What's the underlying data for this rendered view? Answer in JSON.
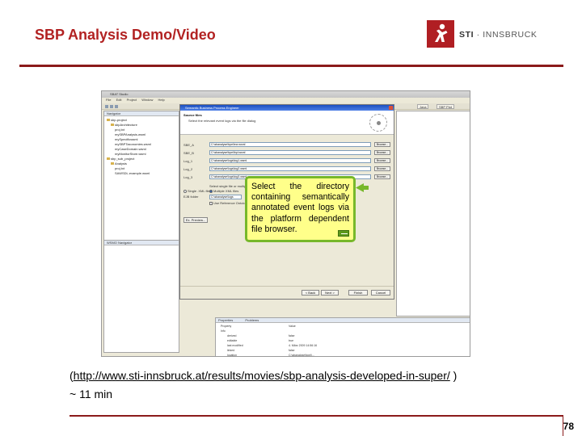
{
  "slide": {
    "title": "SBP Analysis Demo/Video",
    "page_number": "78"
  },
  "logo": {
    "brand": "STI",
    "separator": " · ",
    "place": "INNSBRUCK",
    "color": "#b01e23"
  },
  "screenshot": {
    "window_title": "SBAT Studio",
    "menu": [
      "File",
      "Edit",
      "Project",
      "Window",
      "Help"
    ],
    "perspectives": [
      "Java",
      "SBP Plot"
    ],
    "tree_pane_title": "Navigator",
    "tree_items": [
      "sbp-project",
      "sbpArchitecture",
      "proj.txt",
      "mySBPAnalysis.wsml",
      "mySpecificwsml",
      "mySBPTaxonomies.wsml",
      "myCaseDomain.wsml",
      "myMonitorStore.wsml",
      "sbp_sub_project",
      "Analysis",
      "proj.txt",
      "SAWSDL.example.wsml"
    ],
    "navigator_title": "WSMO Navigator",
    "dialog": {
      "title": "Semantic Business Process Engineer",
      "heading": "Source files",
      "subtitle": "Select the relevant event logs via the file dialog",
      "fields": [
        {
          "label": "SBE_A",
          "value": "C:\\sbanalyse\\bpel\\ecr.wsml",
          "button": "Browse..."
        },
        {
          "label": "SBE_B",
          "value": "C:\\sbanalyse\\bpel\\bpl.wsml",
          "button": "Browse..."
        },
        {
          "label": "Log_1",
          "value": "C:\\sbanalyse\\logs\\log1.wsml",
          "button": "Browse..."
        },
        {
          "label": "Log_2",
          "value": "C:\\sbanalyse\\logs\\log2.wsml",
          "button": "Browse..."
        },
        {
          "label": "Log_3",
          "value": "C:\\sbanalyse\\logs\\log3.wsml",
          "button": "Browse..."
        }
      ],
      "select_label": "Select single file or multiple log files",
      "radio_single": "Single .XML file",
      "radio_multiple": "Multiple XML files",
      "folder_label": "EJB folder",
      "folder_value": "C:\\sbanalyse\\logs",
      "checkbox_label": "Use Reference Ontology",
      "prefs_button": "Ex. Preview...",
      "back_button": "< Back",
      "next_button": "Next >",
      "finish_button": "Finish",
      "cancel_button": "Cancel"
    },
    "callout": {
      "text": "Select the directory containing semantically annotated event logs via the platform dependent file browser."
    },
    "properties": {
      "tabs": [
        "Properties",
        "Problems"
      ],
      "header_property": "Property",
      "header_value": "Value",
      "group": "Info",
      "rows": [
        {
          "key": "derived",
          "value": "false"
        },
        {
          "key": "editable",
          "value": "true"
        },
        {
          "key": "last modified",
          "value": "4. März 2009 14:56:16"
        },
        {
          "key": "linked",
          "value": "false"
        },
        {
          "key": "location",
          "value": "C:\\sbanalyse\\bpel\\..."
        }
      ]
    }
  },
  "caption": {
    "open_paren": "(",
    "url": "http://www.sti-innsbruck.at/results/movies/sbp-analysis-developed-in-super/",
    "close_paren": " )",
    "duration": "~ 11 min"
  }
}
